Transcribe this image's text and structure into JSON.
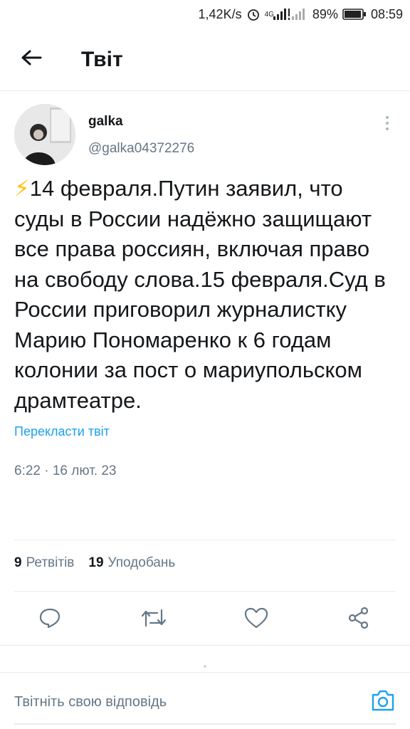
{
  "status_bar": {
    "speed": "1,42K/s",
    "network": "4G",
    "battery": "89%",
    "time": "08:59"
  },
  "header": {
    "title": "Твіт"
  },
  "tweet": {
    "author_name": "galka",
    "author_handle": "@galka04372276",
    "emoji": "⚡",
    "text": "14 февраля.Путин заявил, что суды в России надёжно защищают все права россиян, включая право на свободу слова.15 февраля.Суд в России приговорил журналистку Марию Пономаренко к 6 годам колонии за пост о мариупольском драмтеатре.",
    "translate_label": "Перекласти твіт",
    "timestamp": "6:22 · 16 лют. 23"
  },
  "stats": {
    "retweets_count": "9",
    "retweets_label": "Ретвітів",
    "likes_count": "19",
    "likes_label": "Уподобань"
  },
  "actions": [
    "reply-icon",
    "retweet-icon",
    "like-icon",
    "share-icon"
  ],
  "reply": {
    "placeholder": "Твітніть свою відповідь"
  },
  "colors": {
    "accent": "#1da1f2",
    "text_primary": "#14171a",
    "text_secondary": "#657786",
    "divider": "#e6ecf0"
  }
}
